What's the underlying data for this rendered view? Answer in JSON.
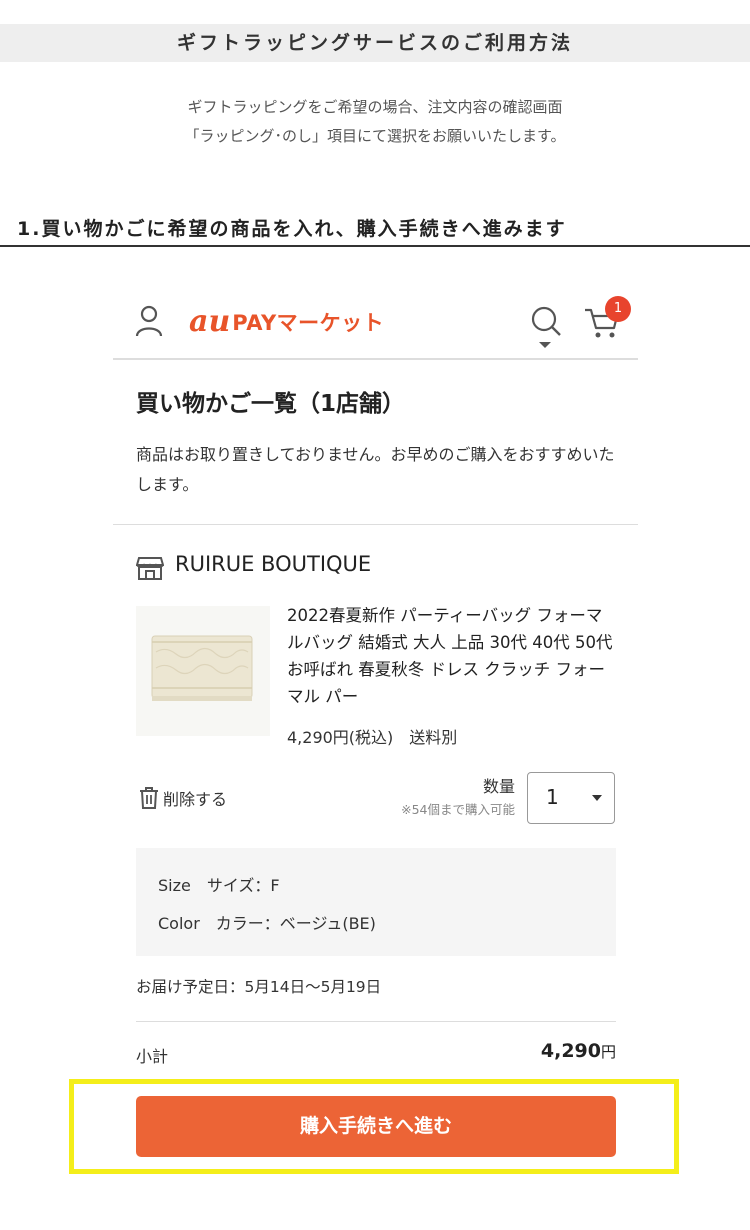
{
  "guide": {
    "header": "ギフトラッピングサービスのご利用方法",
    "intro_line1": "ギフトラッピングをご希望の場合、注文内容の確認画面",
    "intro_line2": "「ラッピング･のし」項目にて選択をお願いいたします。",
    "step_title": "1.買い物かごに希望の商品を入れ、購入手続きへ進みます"
  },
  "app": {
    "logo_au": "au",
    "logo_text": "PAYマーケット",
    "cart_badge": "1",
    "brand_color": "#e8542a"
  },
  "cart": {
    "title": "買い物かご一覧（1店舗）",
    "notice": "商品はお取り置きしておりません。お早めのご購入をおすすめいたします。"
  },
  "shop": {
    "name": "RUIRUE BOUTIQUE"
  },
  "product": {
    "title": "2022春夏新作 パーティーバッグ フォーマルバッグ 結婚式 大人 上品 30代 40代 50代 お呼ばれ 春夏秋冬 ドレス クラッチ フォーマル パー",
    "price": "4,290円(税込)　送料別",
    "delete_label": "削除する",
    "quantity_label": "数量",
    "quantity_limit": "※54個まで購入可能",
    "quantity_value": "1",
    "option_size": "Size　サイズ：F",
    "option_color": "Color　カラー：ベージュ(BE)",
    "delivery": "お届け予定日：5月14日〜5月19日"
  },
  "summary": {
    "subtotal_label": "小計",
    "subtotal_amount": "4,290",
    "subtotal_unit": "円",
    "checkout_label": "購入手続きへ進む",
    "checkout_color": "#ec6436",
    "highlight_color": "#f4ee1a"
  }
}
